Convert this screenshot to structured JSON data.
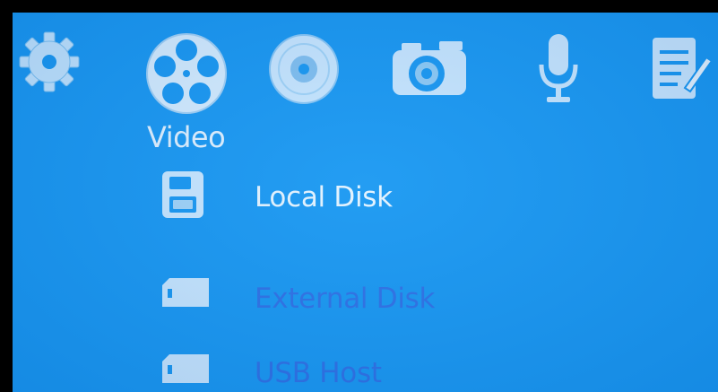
{
  "top_menu": {
    "icons": [
      {
        "name": "settings-gear-icon"
      },
      {
        "name": "video-reel-icon",
        "selected": true
      },
      {
        "name": "music-disc-icon"
      },
      {
        "name": "camera-icon"
      },
      {
        "name": "microphone-icon"
      },
      {
        "name": "notepad-icon"
      }
    ],
    "selected_caption": "Video"
  },
  "storage_list": {
    "items": [
      {
        "label": "Local Disk",
        "icon": "floppy-disk-icon",
        "selected": true
      },
      {
        "label": "External Disk",
        "icon": "sd-card-icon",
        "selected": false
      },
      {
        "label": "USB Host",
        "icon": "usb-card-icon",
        "selected": false
      }
    ]
  },
  "colors": {
    "background": "#1898f2",
    "bezel": "#000000",
    "text_selected": "#e2f3ff",
    "text_unselected": "#2d72e6"
  }
}
